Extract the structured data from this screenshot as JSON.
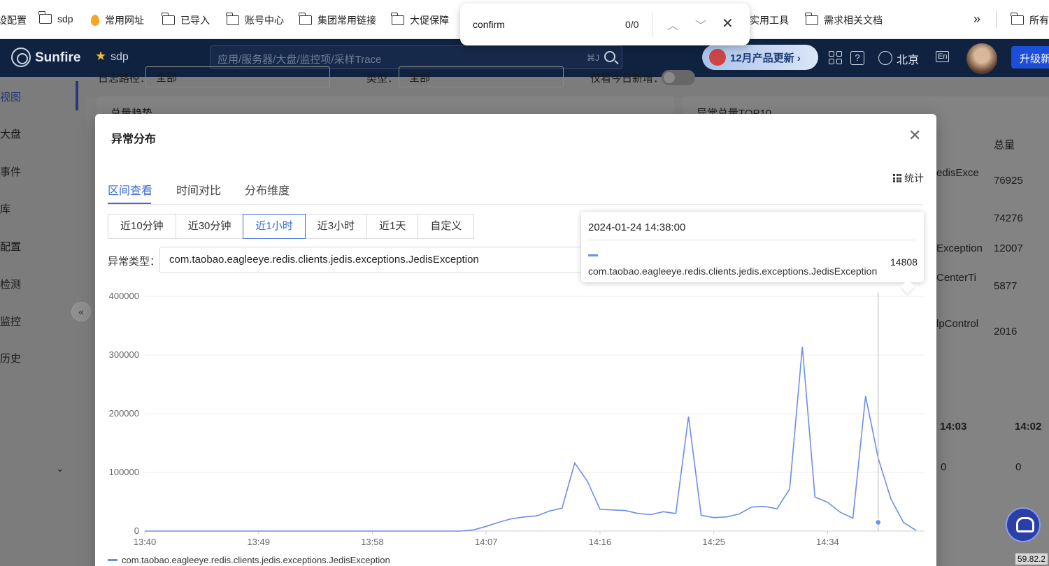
{
  "bookmarks": {
    "items": [
      {
        "label": "设配置",
        "icon": "none"
      },
      {
        "label": "sdp",
        "icon": "folder-icon"
      },
      {
        "label": "常用网址",
        "icon": "flame-icon"
      },
      {
        "label": "已导入",
        "icon": "folder-icon"
      },
      {
        "label": "账号中心",
        "icon": "folder-icon"
      },
      {
        "label": "集团常用链接",
        "icon": "folder-icon"
      },
      {
        "label": "大促保障",
        "icon": "folder-icon"
      },
      {
        "label": "实用工具",
        "icon": "none"
      },
      {
        "label": "需求相关文档",
        "icon": "folder-icon"
      },
      {
        "label": "所有书",
        "icon": "folder-icon"
      }
    ],
    "more": "»"
  },
  "findbar": {
    "query": "confirm",
    "count": "0/0",
    "up": "︿",
    "down": "﹀",
    "close": "✕"
  },
  "header": {
    "brand": "Sunfire",
    "project": "sdp",
    "search_placeholder": "应用/服务器/大盘/监控项/采样Trace",
    "search_shortcut": "⌘J",
    "promo": "12月产品更新 ›",
    "city": "北京",
    "lang": "En",
    "upgrade": "升级新"
  },
  "sidebar": {
    "items": [
      "视图",
      "大盘",
      "事件",
      "库",
      "配置",
      "检测",
      "监控",
      "历史"
    ],
    "collapse": "«",
    "expand": "⌄"
  },
  "background": {
    "filter_labels": [
      "日志路径：",
      "类型：",
      "仅看今日新增："
    ],
    "filter_values": [
      "全部",
      "全部"
    ],
    "panel_left_title": "总量趋势",
    "panel_right_title": "异常总量TOP10",
    "top10": {
      "header_total": "总量",
      "rows": [
        {
          "name": "edisExce",
          "total": "76925"
        },
        {
          "name": "",
          "total": "74276"
        },
        {
          "name": "Exception",
          "total": "12007"
        },
        {
          "name": "CenterTi",
          "total": "5877"
        },
        {
          "name": "lpControl",
          "total": "2016"
        }
      ]
    },
    "time_table": {
      "cols": [
        "14:03",
        "14:02"
      ],
      "values": [
        "0",
        "0"
      ]
    }
  },
  "modal": {
    "title": "异常分布",
    "close": "✕",
    "tabs": [
      "区间查看",
      "时间对比",
      "分布维度"
    ],
    "active_tab": 0,
    "stats_label": "统计",
    "ranges": [
      "近10分钟",
      "近30分钟",
      "近1小时",
      "近3小时",
      "近1天",
      "自定义"
    ],
    "active_range": 2,
    "type_label": "异常类型：",
    "type_value": "com.taobao.eagleeye.redis.clients.jedis.exceptions.JedisException",
    "tooltip": {
      "time": "2024-01-24 14:38:00",
      "series": "com.taobao.eagleeye.redis.clients.jedis.exceptions.JedisException",
      "value": "14808"
    }
  },
  "chart_data": {
    "type": "line",
    "ylim": [
      0,
      400000
    ],
    "yticks": [
      "0",
      "100000",
      "200000",
      "300000",
      "400000"
    ],
    "xticks": [
      "13:40",
      "13:49",
      "13:58",
      "14:07",
      "14:16",
      "14:25",
      "14:34"
    ],
    "xlabel": "",
    "ylabel": "",
    "x": [
      "13:40",
      "13:41",
      "13:42",
      "13:43",
      "13:44",
      "13:45",
      "13:46",
      "13:47",
      "13:48",
      "13:49",
      "13:50",
      "13:51",
      "13:52",
      "13:53",
      "13:54",
      "13:55",
      "13:56",
      "13:57",
      "13:58",
      "13:59",
      "14:00",
      "14:01",
      "14:02",
      "14:03",
      "14:04",
      "14:05",
      "14:06",
      "14:07",
      "14:08",
      "14:09",
      "14:10",
      "14:11",
      "14:12",
      "14:13",
      "14:14",
      "14:15",
      "14:16",
      "14:17",
      "14:18",
      "14:19",
      "14:20",
      "14:21",
      "14:22",
      "14:23",
      "14:24",
      "14:25",
      "14:26",
      "14:27",
      "14:28",
      "14:29",
      "14:30",
      "14:31",
      "14:32",
      "14:33",
      "14:34",
      "14:35",
      "14:36",
      "14:37",
      "14:38",
      "14:39"
    ],
    "series": [
      {
        "name": "com.taobao.eagleeye.redis.clients.jedis.exceptions.JedisException",
        "color": "#6b8fe6",
        "values": [
          0,
          0,
          0,
          0,
          0,
          0,
          0,
          0,
          0,
          0,
          0,
          0,
          0,
          0,
          0,
          0,
          0,
          0,
          0,
          0,
          0,
          0,
          0,
          0,
          0,
          0,
          2000,
          8000,
          15000,
          21000,
          24000,
          26000,
          34000,
          39000,
          116000,
          85000,
          37000,
          36000,
          35000,
          30000,
          28000,
          33000,
          30000,
          195000,
          27000,
          23000,
          24000,
          29000,
          41000,
          42000,
          38000,
          72000,
          314000,
          58000,
          49000,
          32000,
          22000,
          230000,
          124000,
          55000,
          14808,
          1000
        ]
      }
    ],
    "highlight_x": "14:38",
    "highlight_value": 14808,
    "legend": "bottom-left"
  }
}
